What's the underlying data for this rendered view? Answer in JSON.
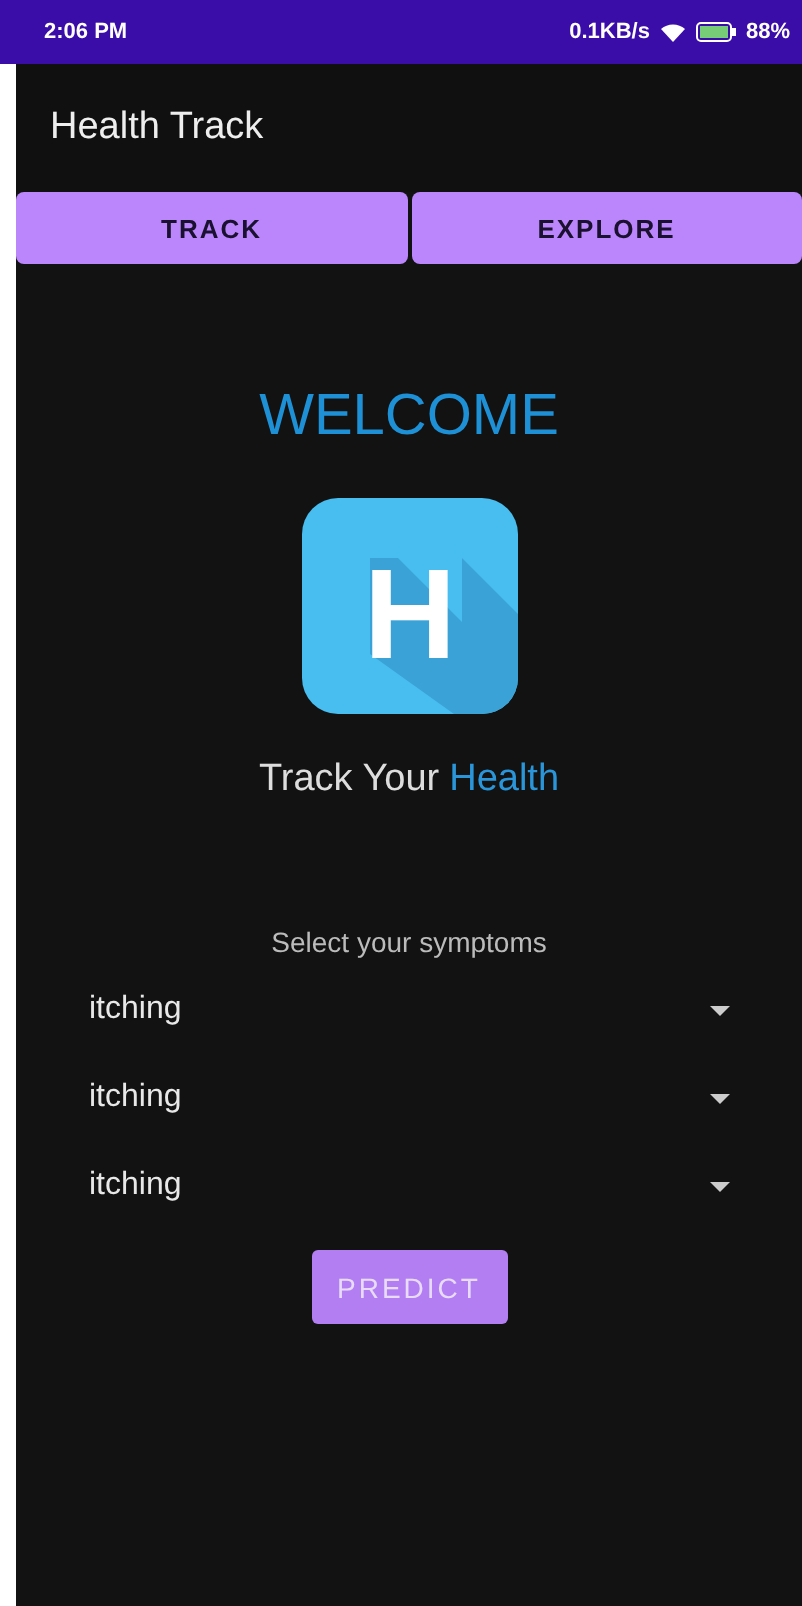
{
  "status_bar": {
    "time": "2:06 PM",
    "speed": "0.1KB/s",
    "battery": "88%"
  },
  "app_bar": {
    "title": "Health Track"
  },
  "tabs": [
    {
      "label": "TRACK"
    },
    {
      "label": "EXPLORE"
    }
  ],
  "welcome": "WELCOME",
  "logo_letter": "H",
  "tagline": {
    "text": "Track Your",
    "highlight": "Health"
  },
  "symptoms": {
    "label": "Select your symptoms",
    "dropdowns": [
      {
        "value": "itching"
      },
      {
        "value": "itching"
      },
      {
        "value": "itching"
      }
    ]
  },
  "predict_button": "PREDICT"
}
